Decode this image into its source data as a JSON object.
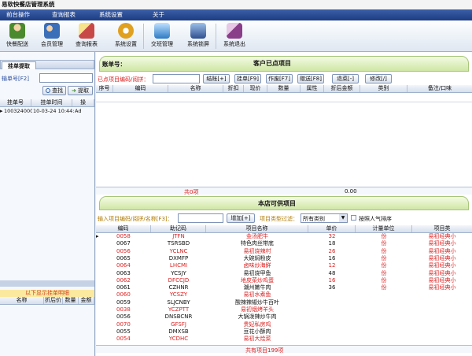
{
  "window": {
    "title": "易软快餐店管理系统"
  },
  "menu": {
    "items": [
      "前台操作",
      "查询报表",
      "系统设置",
      "关于"
    ]
  },
  "toolbar": {
    "items": [
      {
        "label": "快餐配送",
        "icon": "delivery-person-icon",
        "color": "#4b8a2e"
      },
      {
        "label": "会员管理",
        "icon": "members-icon",
        "color": "#3b6fb8"
      },
      {
        "label": "查询报表",
        "icon": "report-icon",
        "color": "#c84848"
      },
      {
        "label": "系统设置",
        "icon": "gear-icon",
        "color": "#e0a020"
      },
      {
        "label": "交班管理",
        "icon": "shift-handover-icon",
        "color": "#2d7bc4"
      },
      {
        "label": "系统锁屏",
        "icon": "lock-screen-icon",
        "color": "#2f4f8f"
      },
      {
        "label": "系统退出",
        "icon": "exit-icon",
        "color": "#8a3e8a"
      }
    ]
  },
  "left": {
    "tab_label": "挂单提取",
    "field_label": "输单号[F2]",
    "search_btn": "查找",
    "extract_btn": "提取",
    "columns": [
      "挂单号",
      "挂单时间",
      "操"
    ],
    "rows": [
      {
        "id": "1003240000",
        "time": "10-03-24 10:44:3",
        "op": "Ad"
      }
    ],
    "detail_title": "以下显示挂单明细",
    "detail_columns": [
      "名称",
      "折后价",
      "数量",
      "金额"
    ]
  },
  "ordered": {
    "account_label": "账单号：",
    "title": "客户已点项目",
    "input_label": "已点项目编码/阅拼：",
    "buttons": [
      "结账[+]",
      "挂单[F9]",
      "作废[F7]",
      "赠送[F8]",
      "退菜[-]",
      "修改[/]"
    ],
    "columns": [
      "序号",
      "编码",
      "名称",
      "折扣",
      "现价",
      "数量",
      "属性",
      "折后金额",
      "类别",
      "备注/口味"
    ],
    "total_text": "共0项",
    "total_amount": "0.00"
  },
  "menu_items": {
    "title": "本店可供项目",
    "input_label": "输入项目编码/阅拼/名称[F3]：",
    "add_btn": "增加[+]",
    "filter_label": "项目类型过滤：",
    "filter_value": "所有类别",
    "sort_label": "按照人气排序",
    "columns": [
      "编码",
      "助记码",
      "项目名称",
      "单价",
      "计量单位",
      "项目类"
    ],
    "rows": [
      {
        "code": "0058",
        "mnemonic": "JTFN",
        "name": "金汤肥牛",
        "price": "32",
        "unit": "份",
        "type": "易初经典小",
        "red": true
      },
      {
        "code": "0067",
        "mnemonic": "TSRSBD",
        "name": "特色肉丝带底",
        "price": "18",
        "unit": "份",
        "type": "易初经典小",
        "red": false
      },
      {
        "code": "0056",
        "mnemonic": "YCLNC",
        "name": "易初烧辣村",
        "price": "26",
        "unit": "份",
        "type": "易初经典小",
        "red": true
      },
      {
        "code": "0065",
        "mnemonic": "DXMFP",
        "name": "大碗焖粉皮",
        "price": "16",
        "unit": "份",
        "type": "易初经典小",
        "red": false
      },
      {
        "code": "0064",
        "mnemonic": "LHCMI",
        "name": "卤味炒海鲜",
        "price": "12",
        "unit": "份",
        "type": "易初经典小",
        "red": true
      },
      {
        "code": "0063",
        "mnemonic": "YCSJY",
        "name": "易初烧甲鱼",
        "price": "48",
        "unit": "份",
        "type": "易初经典小",
        "red": false
      },
      {
        "code": "0062",
        "mnemonic": "DFCCJD",
        "name": "地皮菜炒鸡蛋",
        "price": "16",
        "unit": "份",
        "type": "易初经典小",
        "red": true
      },
      {
        "code": "0061",
        "mnemonic": "CZHNR",
        "name": "潮州嫩牛肉",
        "price": "36",
        "unit": "份",
        "type": "易初经典小",
        "red": false
      },
      {
        "code": "0060",
        "mnemonic": "YCSZY",
        "name": "易初水煮鱼",
        "price": "",
        "unit": "",
        "type": "",
        "red": true
      },
      {
        "code": "0059",
        "mnemonic": "SLJCNBY",
        "name": "酸辣辣椒炒牛百叶",
        "price": "",
        "unit": "",
        "type": "",
        "red": false
      },
      {
        "code": "0038",
        "mnemonic": "YCZPTT",
        "name": "易初烟烤羊头",
        "price": "",
        "unit": "",
        "type": "",
        "red": true
      },
      {
        "code": "0056",
        "mnemonic": "DNSBCNR",
        "name": "大锅泼辣炒牛肉",
        "price": "",
        "unit": "",
        "type": "",
        "red": false
      },
      {
        "code": "0070",
        "mnemonic": "GFSFJ",
        "name": "贵妃私房鸡",
        "price": "",
        "unit": "",
        "type": "",
        "red": true
      },
      {
        "code": "0055",
        "mnemonic": "DMXSB",
        "name": "豆花小酥肉",
        "price": "",
        "unit": "",
        "type": "",
        "red": false
      },
      {
        "code": "0054",
        "mnemonic": "YCDHC",
        "name": "易初大烩菜",
        "price": "",
        "unit": "",
        "type": "",
        "red": true
      }
    ],
    "total_text": "共有项目199项"
  }
}
